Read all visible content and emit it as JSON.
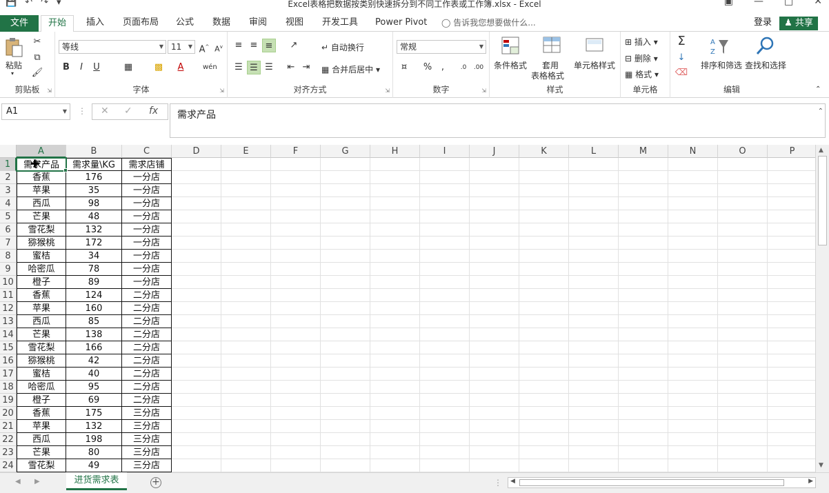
{
  "window": {
    "title": "Excel表格把数据按类别快速拆分到不同工作表或工作簿.xlsx - Excel"
  },
  "tabs": {
    "file": "文件",
    "items": [
      "开始",
      "插入",
      "页面布局",
      "公式",
      "数据",
      "审阅",
      "视图",
      "开发工具",
      "Power Pivot"
    ],
    "active": "开始",
    "tell_me": "告诉我您想要做什么...",
    "login": "登录",
    "share": "共享"
  },
  "ribbon": {
    "clipboard": {
      "label": "剪贴板",
      "paste": "粘贴"
    },
    "font": {
      "label": "字体",
      "font_name": "等线",
      "font_size": "11"
    },
    "alignment": {
      "label": "对齐方式",
      "wrap": "自动换行",
      "merge": "合并后居中"
    },
    "number": {
      "label": "数字",
      "format": "常规"
    },
    "styles": {
      "label": "样式",
      "conditional": "条件格式",
      "table_format_1": "套用",
      "table_format_2": "表格格式",
      "cell_styles": "单元格样式"
    },
    "cells": {
      "label": "单元格",
      "insert": "插入",
      "delete": "删除",
      "format": "格式"
    },
    "editing": {
      "label": "编辑",
      "sort_filter": "排序和筛选",
      "find_select": "查找和选择"
    }
  },
  "formula_bar": {
    "name_box": "A1",
    "content": "需求产品"
  },
  "grid": {
    "columns": [
      "A",
      "B",
      "C",
      "D",
      "E",
      "F",
      "G",
      "H",
      "I",
      "J",
      "K",
      "L",
      "M",
      "N",
      "O",
      "P"
    ],
    "rows": [
      [
        "需求产品",
        "需求量\\KG",
        "需求店铺"
      ],
      [
        "香蕉",
        "176",
        "一分店"
      ],
      [
        "苹果",
        "35",
        "一分店"
      ],
      [
        "西瓜",
        "98",
        "一分店"
      ],
      [
        "芒果",
        "48",
        "一分店"
      ],
      [
        "雪花梨",
        "132",
        "一分店"
      ],
      [
        "猕猴桃",
        "172",
        "一分店"
      ],
      [
        "蜜桔",
        "34",
        "一分店"
      ],
      [
        "哈密瓜",
        "78",
        "一分店"
      ],
      [
        "橙子",
        "89",
        "一分店"
      ],
      [
        "香蕉",
        "124",
        "二分店"
      ],
      [
        "苹果",
        "160",
        "二分店"
      ],
      [
        "西瓜",
        "85",
        "二分店"
      ],
      [
        "芒果",
        "138",
        "二分店"
      ],
      [
        "雪花梨",
        "166",
        "二分店"
      ],
      [
        "猕猴桃",
        "42",
        "二分店"
      ],
      [
        "蜜桔",
        "40",
        "二分店"
      ],
      [
        "哈密瓜",
        "95",
        "二分店"
      ],
      [
        "橙子",
        "69",
        "二分店"
      ],
      [
        "香蕉",
        "175",
        "三分店"
      ],
      [
        "苹果",
        "132",
        "三分店"
      ],
      [
        "西瓜",
        "198",
        "三分店"
      ],
      [
        "芒果",
        "80",
        "三分店"
      ],
      [
        "雪花梨",
        "49",
        "三分店"
      ]
    ]
  },
  "sheets": {
    "active": "进货需求表"
  }
}
